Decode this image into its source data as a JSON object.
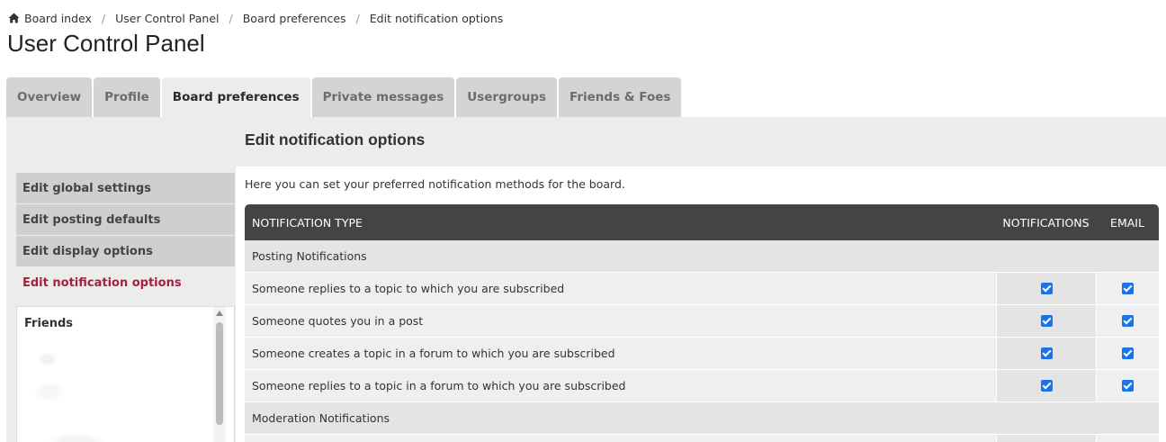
{
  "breadcrumbs": [
    {
      "label": "Board index",
      "icon": "home-icon"
    },
    {
      "label": "User Control Panel"
    },
    {
      "label": "Board preferences"
    },
    {
      "label": "Edit notification options"
    }
  ],
  "breadcrumb_separator": "/",
  "page_title": "User Control Panel",
  "tabs": [
    {
      "label": "Overview"
    },
    {
      "label": "Profile"
    },
    {
      "label": "Board preferences",
      "active": true
    },
    {
      "label": "Private messages"
    },
    {
      "label": "Usergroups"
    },
    {
      "label": "Friends & Foes"
    }
  ],
  "sidebar": {
    "items": [
      {
        "label": "Edit global settings"
      },
      {
        "label": "Edit posting defaults"
      },
      {
        "label": "Edit display options"
      },
      {
        "label": "Edit notification options",
        "active": true
      }
    ],
    "friends_title": "Friends"
  },
  "main": {
    "title": "Edit notification options",
    "intro": "Here you can set your preferred notification methods for the board.",
    "table": {
      "headers": {
        "type": "NOTIFICATION TYPE",
        "notifications": "NOTIFICATIONS",
        "email": "EMAIL"
      },
      "groups": [
        {
          "label": "Posting Notifications"
        },
        {
          "label": "Moderation Notifications"
        }
      ],
      "rows": [
        {
          "label": "Someone replies to a topic to which you are subscribed",
          "notifications": true,
          "email": true
        },
        {
          "label": "Someone quotes you in a post",
          "notifications": true,
          "email": true
        },
        {
          "label": "Someone creates a topic in a forum to which you are subscribed",
          "notifications": true,
          "email": true
        },
        {
          "label": "Someone replies to a topic in a forum to which you are subscribed",
          "notifications": true,
          "email": true
        }
      ]
    }
  },
  "colors": {
    "accent_active": "#a6203e",
    "header_dark": "#444444",
    "checkbox": "#1a73e8"
  }
}
